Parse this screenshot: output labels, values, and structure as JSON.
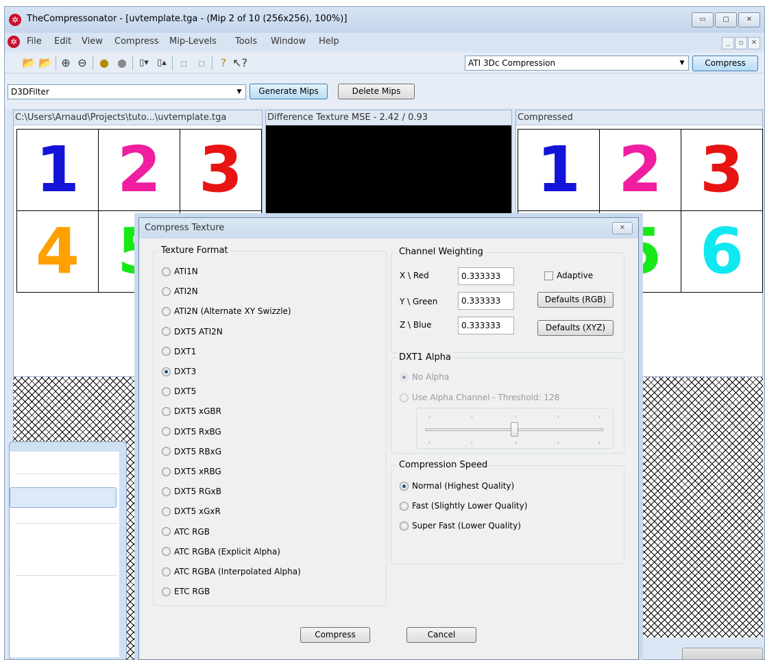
{
  "window": {
    "title": "TheCompressonator - [uvtemplate.tga - (Mip 2 of 10 (256x256), 100%)]",
    "controls": [
      "▭",
      "▢",
      "✕"
    ]
  },
  "menu": {
    "items": [
      "File",
      "Edit",
      "View",
      "Compress",
      "Mip-Levels",
      "Tools",
      "Window",
      "Help"
    ],
    "mdi_controls": [
      "_",
      "▫",
      "✕"
    ]
  },
  "toolbar": {
    "compression_type": "ATI 3Dc Compression",
    "compress_label": "Compress",
    "filter": "D3DFilter",
    "generate_mips_label": "Generate Mips",
    "delete_mips_label": "Delete Mips"
  },
  "panes": {
    "original_title": "C:\\Users\\Arnaud\\Projects\\tuto...\\uvtemplate.tga",
    "difference_title": "Difference Texture MSE - 2.42 / 0.93",
    "compressed_title": "Compressed",
    "tiles": [
      {
        "digit": "1",
        "color": "#1414d8"
      },
      {
        "digit": "2",
        "color": "#f01ea0"
      },
      {
        "digit": "3",
        "color": "#e81414"
      },
      {
        "digit": "4",
        "color": "#ffa000"
      },
      {
        "digit": "5",
        "color": "#18e818"
      },
      {
        "digit": "6",
        "color": "#10e8f0"
      }
    ]
  },
  "dialog": {
    "title": "Compress Texture",
    "close_label": "✕",
    "texture_format": {
      "label": "Texture Format",
      "options": [
        "ATI1N",
        "ATI2N",
        "ATI2N (Alternate XY Swizzle)",
        "DXT5 ATI2N",
        "DXT1",
        "DXT3",
        "DXT5",
        "DXT5 xGBR",
        "DXT5 RxBG",
        "DXT5 RBxG",
        "DXT5 xRBG",
        "DXT5 RGxB",
        "DXT5 xGxR",
        "ATC RGB",
        "ATC RGBA (Explicit Alpha)",
        "ATC RGBA (Interpolated Alpha)",
        "ETC RGB"
      ],
      "selected": "DXT3"
    },
    "channel_weighting": {
      "label": "Channel Weighting",
      "red_label": "X \\ Red",
      "red_value": "0.333333",
      "green_label": "Y \\ Green",
      "green_value": "0.333333",
      "blue_label": "Z \\ Blue",
      "blue_value": "0.333333",
      "adaptive_label": "Adaptive",
      "defaults_rgb_label": "Defaults (RGB)",
      "defaults_xyz_label": "Defaults (XYZ)"
    },
    "dxt1_alpha": {
      "label": "DXT1 Alpha",
      "no_alpha_label": "No Alpha",
      "use_alpha_label": "Use Alpha Channel - Threshold: 128",
      "threshold_fraction": 0.5
    },
    "compression_speed": {
      "label": "Compression Speed",
      "options": [
        "Normal (Highest Quality)",
        "Fast (Slightly Lower Quality)",
        "Super Fast (Lower Quality)"
      ],
      "selected": "Normal (Highest Quality)"
    },
    "compress_label": "Compress",
    "cancel_label": "Cancel"
  }
}
